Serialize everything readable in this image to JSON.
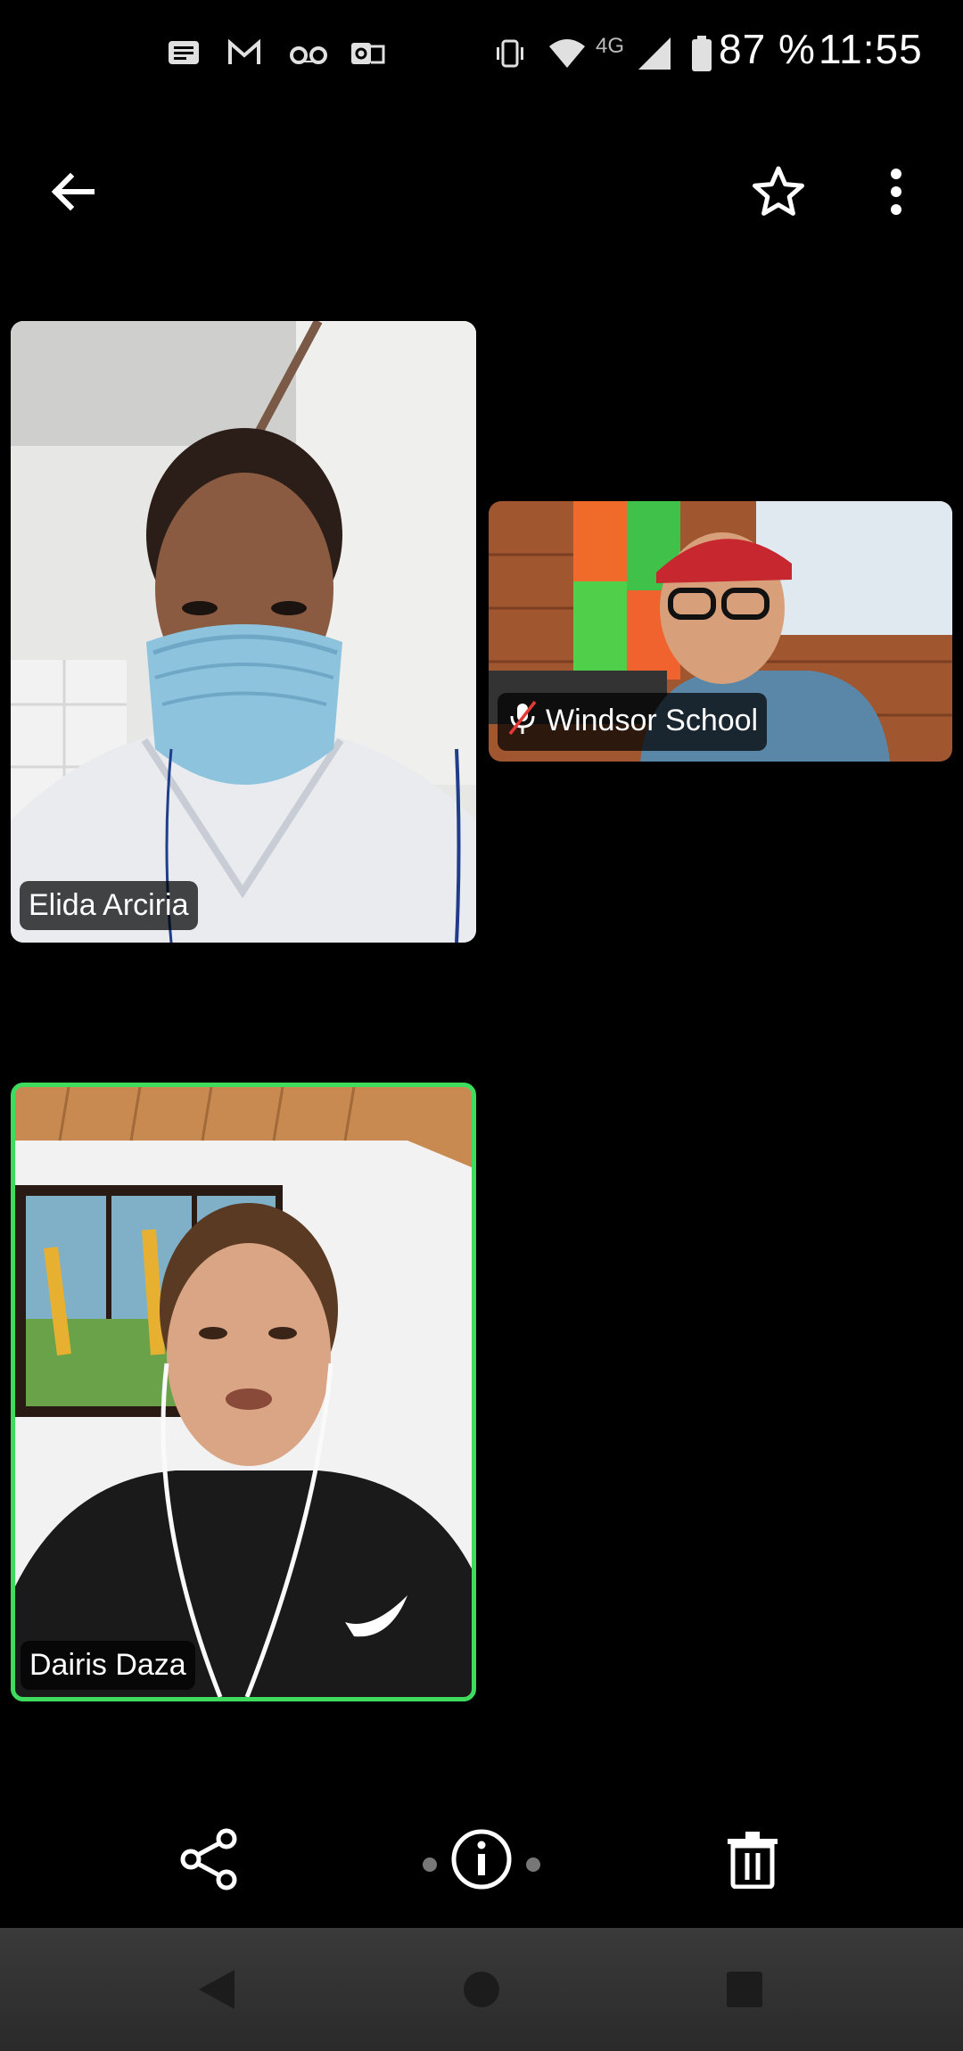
{
  "status_bar": {
    "notification_icons": [
      "messages-icon",
      "gmail-icon",
      "voicemail-icon",
      "outlook-icon"
    ],
    "system_icons": [
      "vibrate-icon",
      "wifi-icon",
      "signal-icon",
      "battery-icon"
    ],
    "network": "4G",
    "battery": "87 %",
    "time": "11:55"
  },
  "app_bar": {
    "back_icon": "arrow-left-icon",
    "favorite_icon": "star-outline-icon",
    "more_icon": "more-vertical-icon"
  },
  "participants": [
    {
      "name": "Elida Arciria",
      "muted": false,
      "active_speaker": false
    },
    {
      "name": "Windsor School",
      "muted": true,
      "active_speaker": false
    },
    {
      "name": "Dairis Daza",
      "muted": false,
      "active_speaker": true
    }
  ],
  "actions": {
    "share_icon": "share-icon",
    "info_icon": "info-icon",
    "delete_icon": "trash-icon"
  },
  "nav_bar": {
    "back_icon": "nav-back-icon",
    "home_icon": "nav-home-icon",
    "recents_icon": "nav-recents-icon"
  },
  "colors": {
    "background": "#000000",
    "active_speaker_border": "#3ddc5c",
    "muted_mic": "#e53935"
  }
}
